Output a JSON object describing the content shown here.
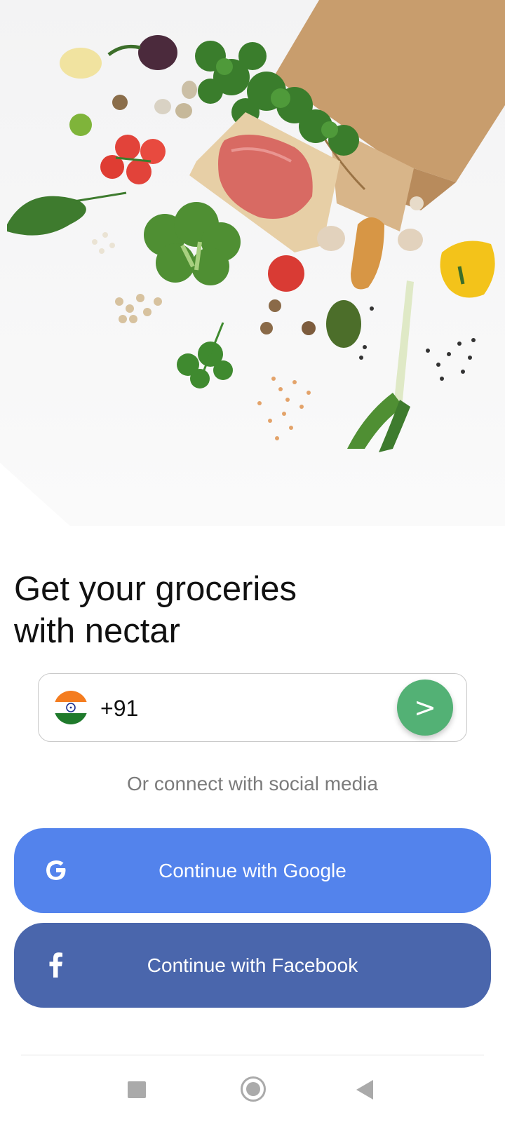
{
  "hero": {
    "image": "groceries-spill-from-paper-bag"
  },
  "headline": {
    "line1": "Get your groceries",
    "line2": "with nectar"
  },
  "phone": {
    "country_flag": "india-flag-icon",
    "dial_code": "+91",
    "next_symbol": ">",
    "next_color": "#53b175"
  },
  "social": {
    "caption": "Or connect with social media",
    "google": {
      "label": "Continue with Google",
      "icon": "google-g-icon",
      "color": "#5383ec"
    },
    "facebook": {
      "label": "Continue with Facebook",
      "icon": "facebook-f-icon",
      "color": "#4a66ac"
    }
  },
  "navigation": {
    "buttons": [
      "recent-apps",
      "home",
      "back"
    ]
  }
}
